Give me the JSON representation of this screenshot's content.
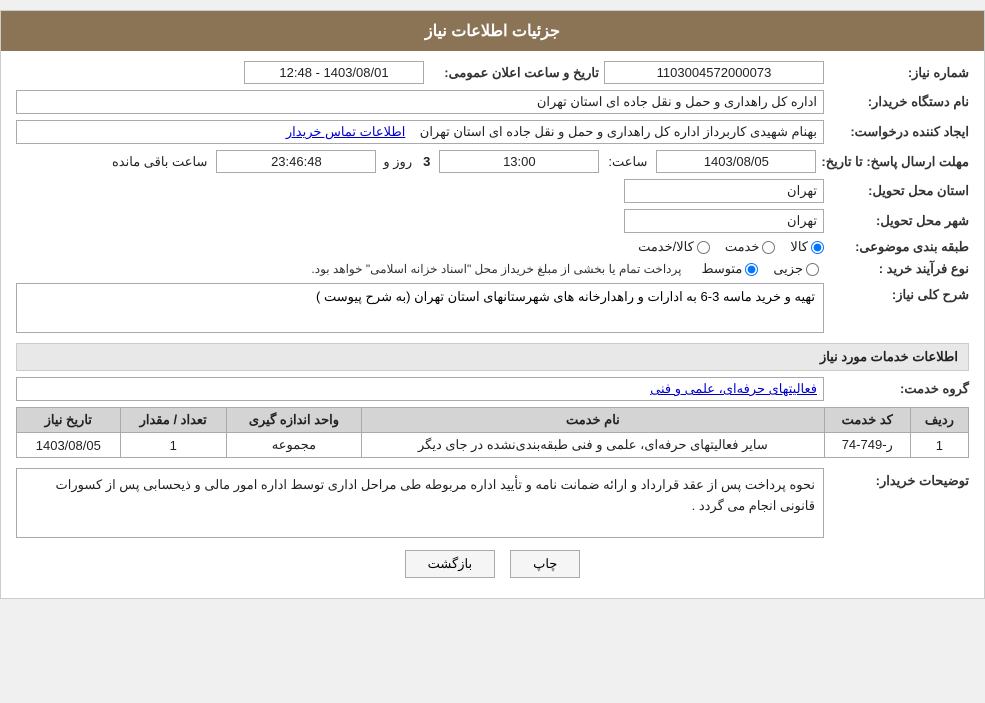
{
  "header": {
    "title": "جزئیات اطلاعات نیاز"
  },
  "fields": {
    "need_number_label": "شماره نیاز:",
    "need_number_value": "1103004572000073",
    "announce_date_label": "تاریخ و ساعت اعلان عمومی:",
    "announce_date_value": "1403/08/01 - 12:48",
    "requester_org_label": "نام دستگاه خریدار:",
    "requester_org_value": "اداره کل راهداری و حمل و نقل جاده ای استان تهران",
    "creator_label": "ایجاد کننده درخواست:",
    "creator_value": "بهنام شهیدی کاربرداز اداره کل راهداری و حمل و نقل جاده ای استان تهران",
    "contact_link": "اطلاعات تماس خریدار",
    "deadline_label": "مهلت ارسال پاسخ: تا تاریخ:",
    "deadline_date": "1403/08/05",
    "deadline_time_label": "ساعت:",
    "deadline_time": "13:00",
    "remaining_days_label": "روز و",
    "remaining_days": "3",
    "remaining_time": "23:46:48",
    "remaining_suffix": "ساعت باقی مانده",
    "province_label": "استان محل تحویل:",
    "province_value": "تهران",
    "city_label": "شهر محل تحویل:",
    "city_value": "تهران",
    "subject_label": "طبقه بندی موضوعی:",
    "subject_options": [
      "کالا",
      "خدمت",
      "کالا/خدمت"
    ],
    "subject_selected": "کالا",
    "purchase_type_label": "نوع فرآیند خرید :",
    "purchase_options": [
      "جزیی",
      "متوسط"
    ],
    "purchase_selected": "متوسط",
    "purchase_note": "پرداخت تمام یا بخشی از مبلغ خریداز محل \"اسناد خزانه اسلامی\" خواهد بود.",
    "needs_label": "شرح کلی نیاز:",
    "needs_value": "تهیه و خرید ماسه 3-6 به ادارات و راهدارخانه های شهرستانهای استان تهران (به شرح پیوست )",
    "service_info_header": "اطلاعات خدمات مورد نیاز",
    "service_group_label": "گروه خدمت:",
    "service_group_value": "فعالیتهای حرفه‌ای، علمی و فنی",
    "table": {
      "headers": [
        "ردیف",
        "کد خدمت",
        "نام خدمت",
        "واحد اندازه گیری",
        "تعداد / مقدار",
        "تاریخ نیاز"
      ],
      "rows": [
        {
          "row": "1",
          "code": "ر-749-74",
          "name": "سایر فعالیتهای حرفه‌ای، علمی و فنی طبقه‌بندی‌نشده در جای دیگر",
          "unit": "مجموعه",
          "quantity": "1",
          "date": "1403/08/05"
        }
      ]
    },
    "buyer_desc_label": "توضیحات خریدار:",
    "buyer_desc_value": "نحوه پرداخت پس از عقد قرارداد و ارائه ضمانت نامه و تأیید اداره مربوطه طی مراحل اداری توسط اداره امور مالی و ذیحسابی پس از کسورات قانونی انجام می گردد .",
    "buttons": {
      "print": "چاپ",
      "back": "بازگشت"
    }
  }
}
